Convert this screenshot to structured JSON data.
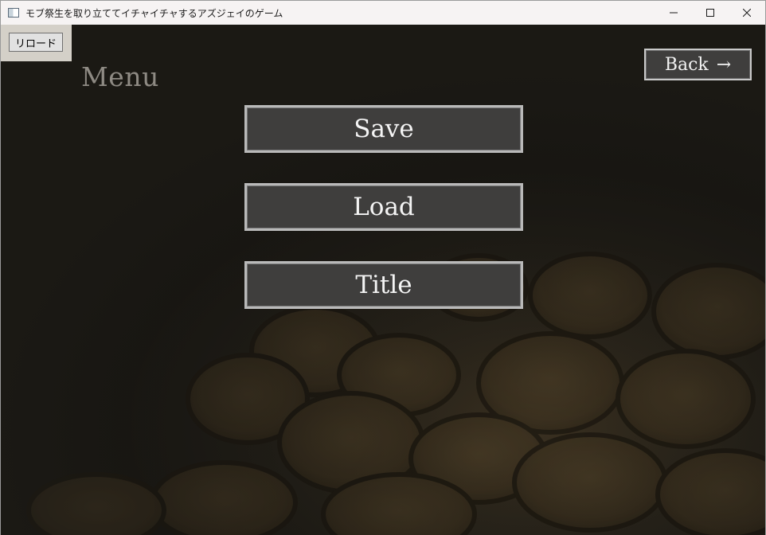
{
  "window": {
    "title": "モブ祭生を取り立ててイチャイチャするアズジェイのゲーム",
    "icon": "app-window-icon",
    "controls": [
      "minimize-icon",
      "maximize-icon",
      "close-icon"
    ]
  },
  "toolbar": {
    "reload_label": "リロード"
  },
  "menu": {
    "heading": "Menu",
    "back_label": "Back",
    "back_arrow": "→",
    "buttons": {
      "save": "Save",
      "load": "Load",
      "title": "Title"
    }
  },
  "colors": {
    "button_bg": "#3f3e3d",
    "button_border": "#b9b9b9",
    "heading": "#8e8a83",
    "background": "#1c1a15"
  }
}
